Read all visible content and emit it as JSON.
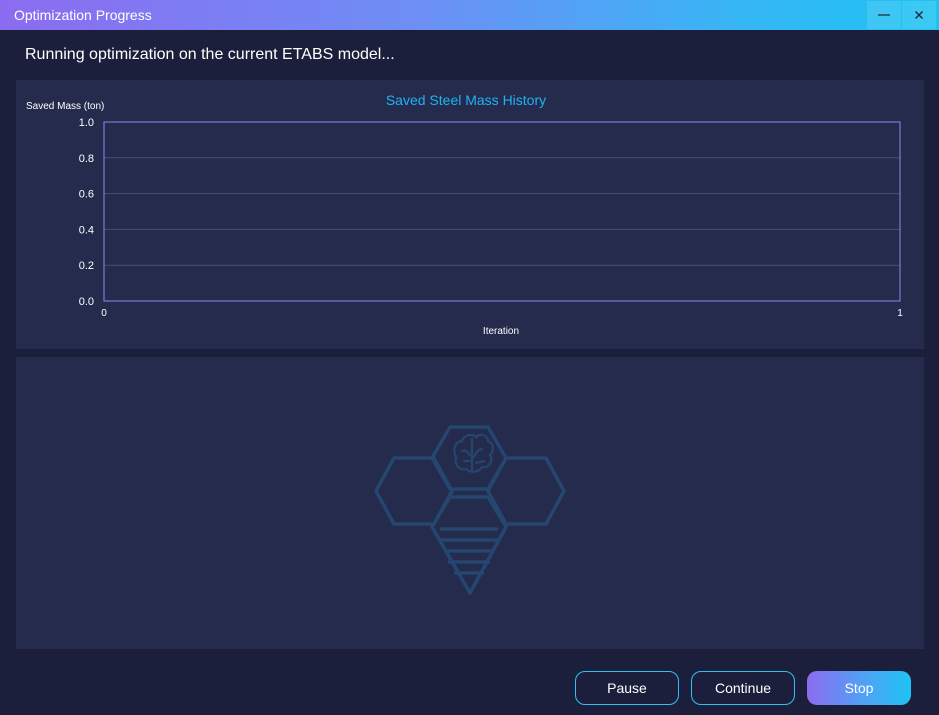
{
  "window": {
    "title": "Optimization Progress",
    "minimize_icon": "minimize-icon",
    "close_icon": "close-icon"
  },
  "status_message": "Running optimization on the current ETABS model...",
  "chart_data": {
    "type": "line",
    "title": "Saved Steel Mass History",
    "xlabel": "Iteration",
    "ylabel": "Saved Mass (ton)",
    "xlim": [
      0,
      1
    ],
    "ylim": [
      0,
      1
    ],
    "x_ticks": [
      "0",
      "1"
    ],
    "y_ticks": [
      "0.0",
      "0.2",
      "0.4",
      "0.6",
      "0.8",
      "1.0"
    ],
    "series": [],
    "grid": true
  },
  "logo": {
    "icon": "bee-brain-logo-icon"
  },
  "buttons": {
    "pause": "Pause",
    "continue": "Continue",
    "stop": "Stop"
  },
  "colors": {
    "accent": "#1ec3f2",
    "accent_purple": "#8b6cf0",
    "background": "#1b1f3b",
    "panel": "#252b4d",
    "plot_border": "#8f86ee",
    "chart_title": "#1eb4f0"
  }
}
